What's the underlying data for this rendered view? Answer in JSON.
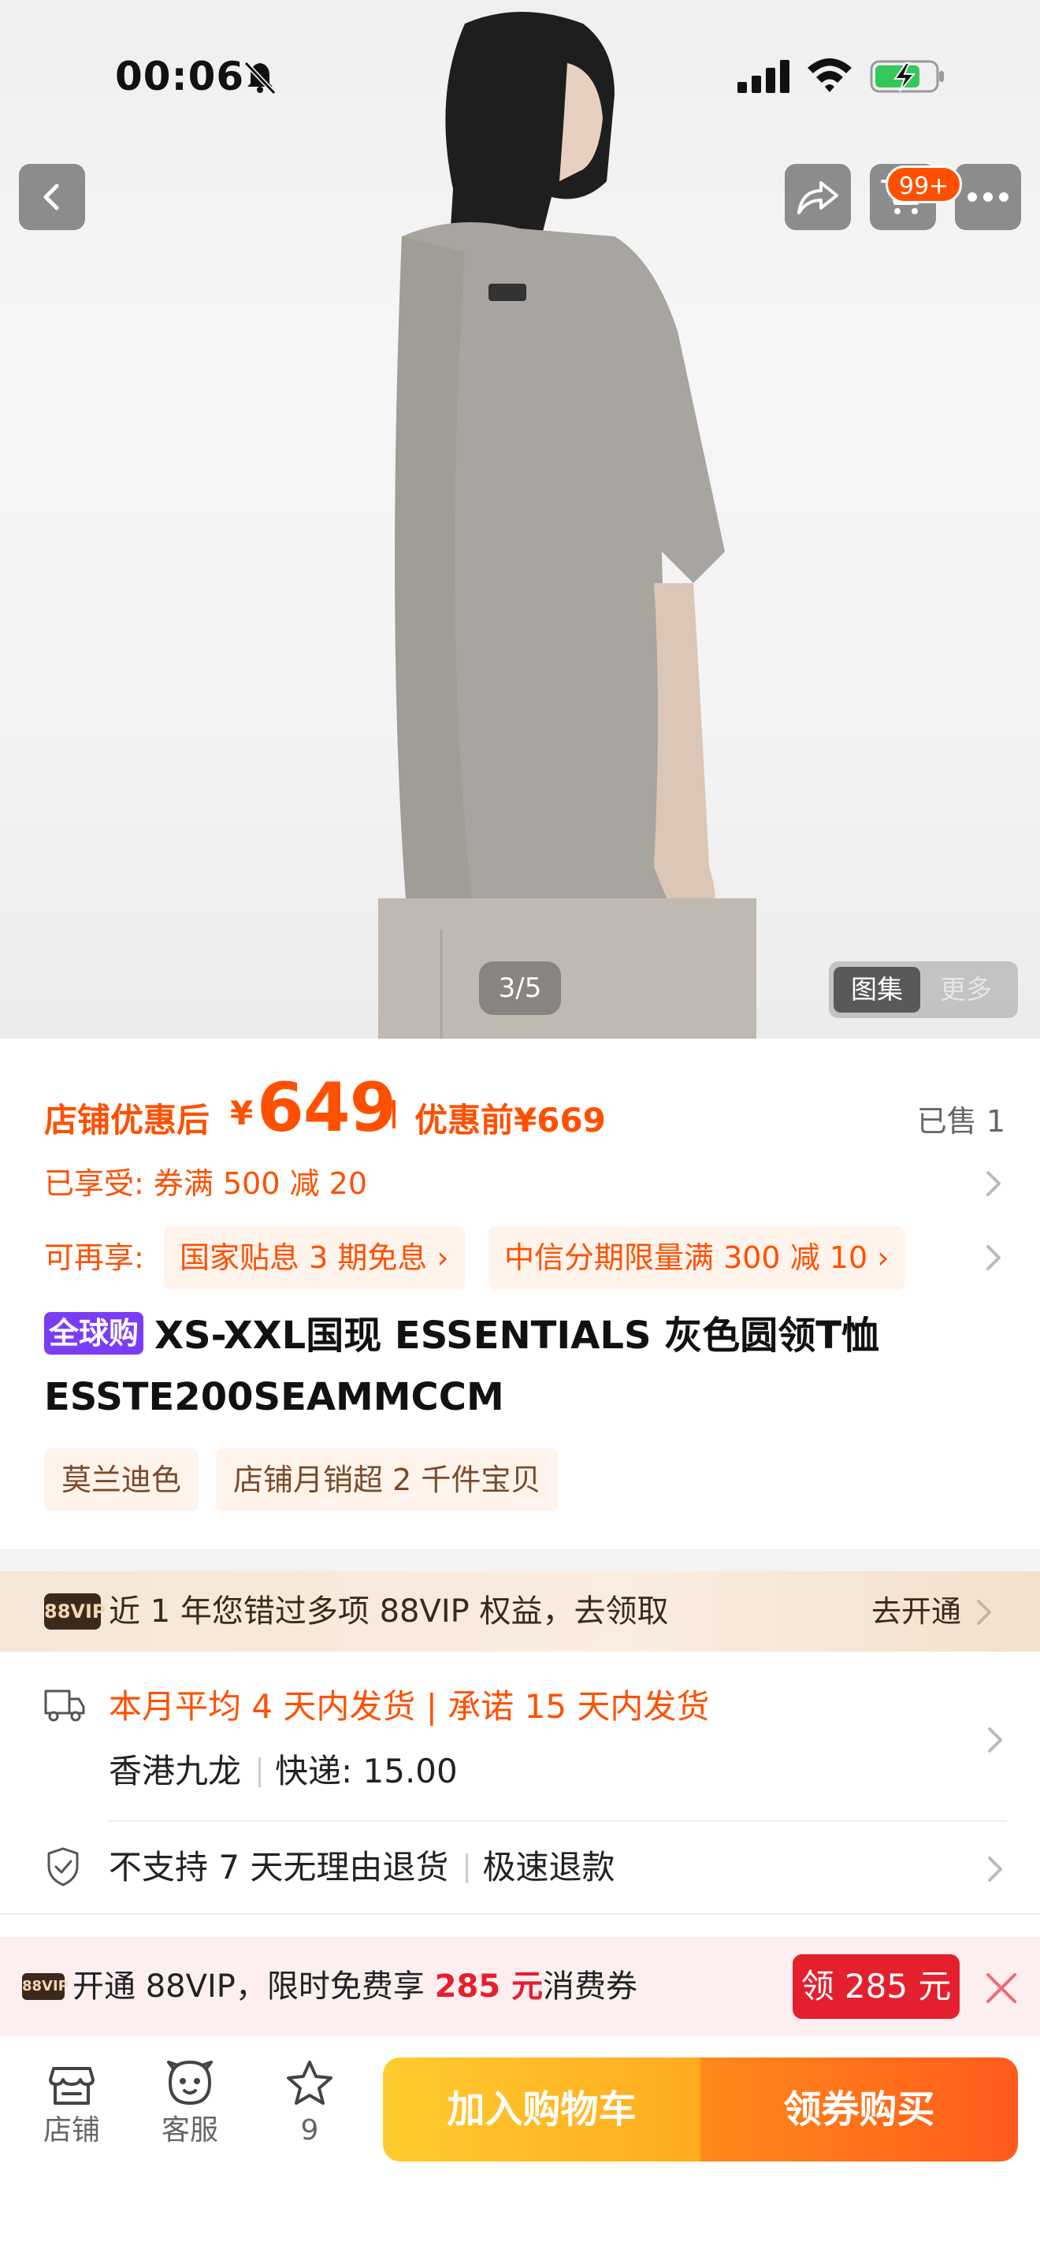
{
  "status_bar": {
    "time": "00:06"
  },
  "nav": {
    "cart_badge": "99+"
  },
  "gallery": {
    "counter": "3/5",
    "tab_active": "图集",
    "tab_inactive": "更多"
  },
  "price": {
    "label": "店铺优惠后",
    "symbol": "¥",
    "value": "649",
    "before_label": "优惠前¥669",
    "sold": "已售 1"
  },
  "coupon": {
    "text": "已享受: 券满 500 减 20"
  },
  "extra": {
    "label": "可再享:",
    "chip1": "国家贴息 3 期免息 ›",
    "chip2": "中信分期限量满 300 减 10 ›"
  },
  "product": {
    "badge": "全球购",
    "title": "XS-XXL国现 ESSENTIALS 灰色圆领T恤 ESSTE200SEAMMCCM"
  },
  "tags": [
    "莫兰迪色",
    "店铺月销超 2 千件宝贝"
  ],
  "vip_banner": {
    "badge": "88VIP",
    "text": "近 1 年您错过多项 88VIP 权益，去领取",
    "action": "去开通"
  },
  "delivery": {
    "line1": "本月平均 4 天内发货 | 承诺 15 天内发货",
    "origin": "香港九龙",
    "shipping": "快递: 15.00"
  },
  "returns": {
    "policy": "不支持 7 天无理由退货",
    "refund": "极速退款"
  },
  "promo": {
    "badge": "88VIP",
    "prefix": "开通 88VIP，限时免费享 ",
    "amount": "285 元",
    "suffix": "消费券",
    "button": "领 285 元"
  },
  "bottom": {
    "shop": "店铺",
    "service": "客服",
    "favorites": "9",
    "add_to_cart": "加入购物车",
    "buy": "领券购买"
  },
  "colors": {
    "accent": "#ff5000",
    "promo_red": "#e4202f",
    "global_buy": "#7b3cf5",
    "cta_yellow": "#ffba24",
    "cta_orange": "#ff6a1c"
  }
}
